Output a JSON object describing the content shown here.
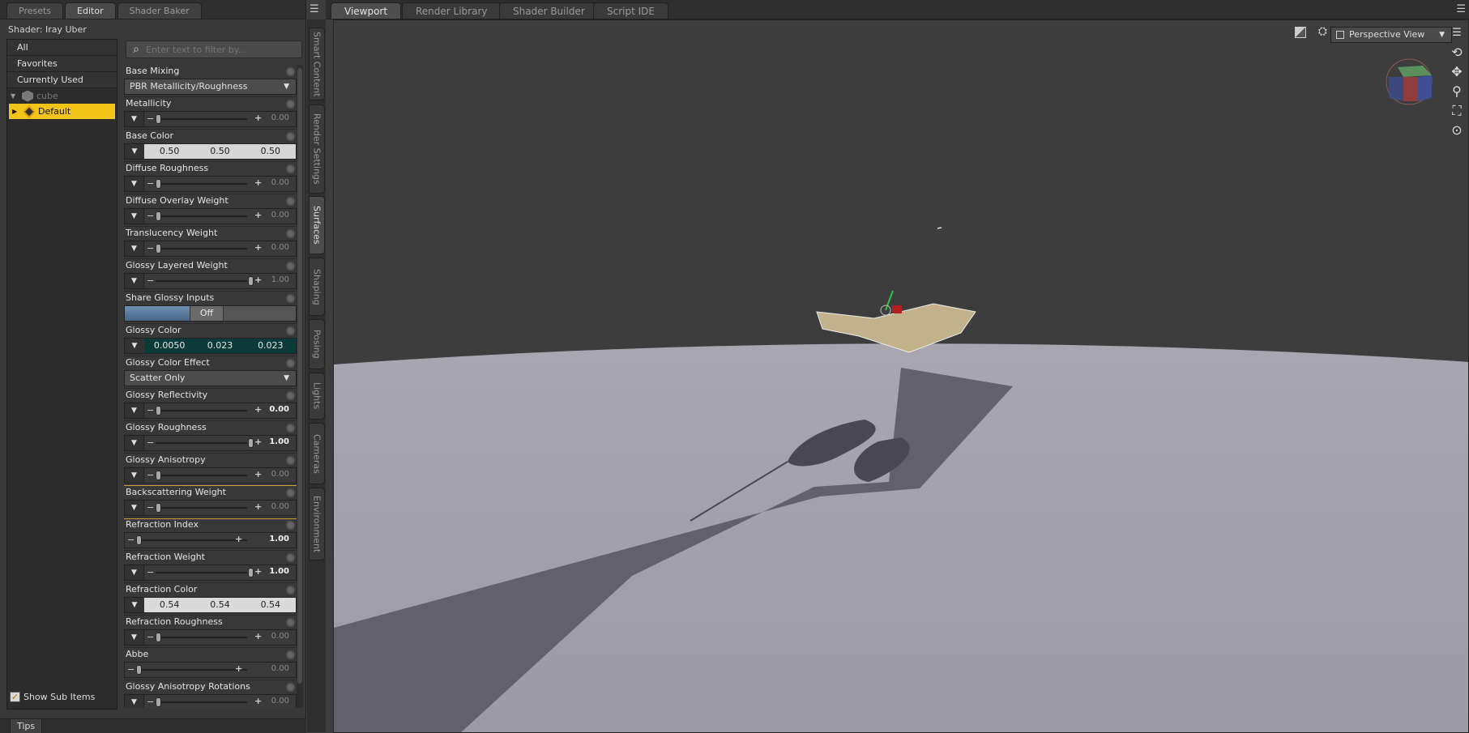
{
  "left_tabs": [
    "Presets",
    "Editor",
    "Shader Baker"
  ],
  "shader_label": "Shader: Iray Uber",
  "tree": {
    "filters": [
      "All",
      "Favorites",
      "Currently Used"
    ],
    "node": "cube",
    "material": "Default"
  },
  "show_sub_items": "Show Sub Items",
  "filter_placeholder": "Enter text to filter by...",
  "properties": [
    {
      "label": "Base Mixing",
      "kind": "dropdown",
      "value": "PBR Metallicity/Roughness"
    },
    {
      "label": "Metallicity",
      "kind": "slider",
      "value": "0.00",
      "pos": 0
    },
    {
      "label": "Base Color",
      "kind": "color",
      "values": [
        "0.50",
        "0.50",
        "0.50"
      ],
      "color": "#d6d6d6"
    },
    {
      "label": "Diffuse Roughness",
      "kind": "slider",
      "value": "0.00",
      "pos": 0
    },
    {
      "label": "Diffuse Overlay Weight",
      "kind": "slider",
      "value": "0.00",
      "pos": 0
    },
    {
      "label": "Translucency Weight",
      "kind": "slider",
      "value": "0.00",
      "pos": 0
    },
    {
      "label": "Glossy Layered Weight",
      "kind": "slider",
      "value": "1.00",
      "pos": 1
    },
    {
      "label": "Share Glossy Inputs",
      "kind": "toggle",
      "value": "Off"
    },
    {
      "label": "Glossy Color",
      "kind": "color",
      "values": [
        "0.0050",
        "0.023",
        "0.023"
      ],
      "color": "#0c3a38"
    },
    {
      "label": "Glossy Color Effect",
      "kind": "dropdown",
      "value": "Scatter Only"
    },
    {
      "label": "Glossy Reflectivity",
      "kind": "slider",
      "value": "0.00",
      "pos": 0,
      "bold": true
    },
    {
      "label": "Glossy Roughness",
      "kind": "slider",
      "value": "1.00",
      "pos": 1,
      "bold": true
    },
    {
      "label": "Glossy Anisotropy",
      "kind": "slider",
      "value": "0.00",
      "pos": 0
    },
    {
      "label": "Backscattering Weight",
      "kind": "slider",
      "value": "0.00",
      "pos": 0,
      "highlight": true
    },
    {
      "label": "Refraction Index",
      "kind": "slider",
      "value": "1.00",
      "pos": 0,
      "bold": true,
      "noarrow": true
    },
    {
      "label": "Refraction Weight",
      "kind": "slider",
      "value": "1.00",
      "pos": 1,
      "bold": true
    },
    {
      "label": "Refraction Color",
      "kind": "color",
      "values": [
        "0.54",
        "0.54",
        "0.54"
      ],
      "color": "#dadada"
    },
    {
      "label": "Refraction Roughness",
      "kind": "slider",
      "value": "0.00",
      "pos": 0
    },
    {
      "label": "Abbe",
      "kind": "slider",
      "value": "0.00",
      "pos": 0,
      "noarrow": true
    },
    {
      "label": "Glossy Anisotropy Rotations",
      "kind": "slider",
      "value": "0.00",
      "pos": 0
    }
  ],
  "vertical_tabs": [
    "Smart Content",
    "Render Settings",
    "Surfaces",
    "Shaping",
    "Posing",
    "Lights",
    "Cameras",
    "Environment"
  ],
  "active_vertical_tab": "Surfaces",
  "viewport_tabs": [
    "Viewport",
    "Render Library",
    "Shader Builder",
    "Script IDE"
  ],
  "view_mode": "Perspective View",
  "tips_label": "Tips",
  "colors": {
    "selection": "#f2c418",
    "highlight": "#c9a43a",
    "floor": "#a09ea7",
    "background": "#3d3d3d",
    "object": "#c2b28c"
  }
}
